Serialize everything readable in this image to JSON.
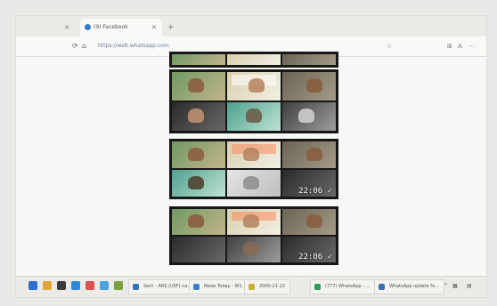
{
  "browser": {
    "tabs": [
      {
        "label": "",
        "active": false
      },
      {
        "label": "(9) Facebook",
        "active": true
      }
    ],
    "url": "https://web.whatsapp.com"
  },
  "video_tiles": [
    {
      "timestamp": ""
    },
    {
      "timestamp": ""
    },
    {
      "timestamp": "22:06 ✓"
    },
    {
      "timestamp": "22:06 ✓"
    }
  ],
  "taskbar": {
    "items": [
      {
        "label": "Sent - ARS (USF) na…",
        "color": "#2f75c4"
      },
      {
        "label": "News Today - W1…",
        "color": "#3a80c9"
      },
      {
        "label": "2000-21-22",
        "color": "#ccae35"
      },
      {
        "label": "(777) WhatsApp - …",
        "color": "#2c9b58"
      },
      {
        "label": "WhatsApp update fe…",
        "color": "#3c6fb6"
      }
    ]
  }
}
